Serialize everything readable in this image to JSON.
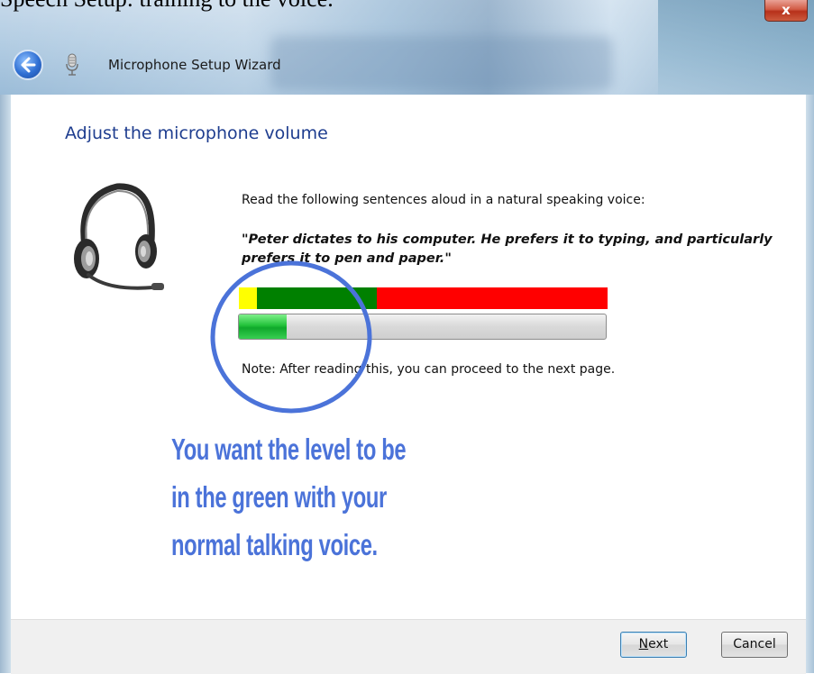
{
  "document": {
    "caption": "Speech Setup: training to the voice."
  },
  "window": {
    "title": "Microphone Setup Wizard",
    "close_label": "x"
  },
  "page": {
    "heading": "Adjust the microphone volume",
    "instructions": "Read the following sentences aloud in a natural speaking voice:",
    "quote": "\"Peter dictates to his computer. He prefers it to typing, and particularly prefers it to pen and paper.\"",
    "note": "Note: After reading this, you can proceed to the next page."
  },
  "level_indicator": {
    "zones": [
      "yellow",
      "green",
      "red"
    ],
    "colors": {
      "yellow": "#ffff00",
      "green": "#008000",
      "red": "#ff0000"
    },
    "current_level_fraction": 0.13
  },
  "annotation": {
    "color": "#4b73d9",
    "lines": [
      "You want the level to be",
      "in the green with your",
      "normal talking voice."
    ]
  },
  "buttons": {
    "next_mnemonic": "N",
    "next_rest": "ext",
    "cancel": "Cancel"
  },
  "icons": {
    "back": "back-arrow-icon",
    "microphone": "microphone-icon",
    "headset": "headset-icon"
  }
}
